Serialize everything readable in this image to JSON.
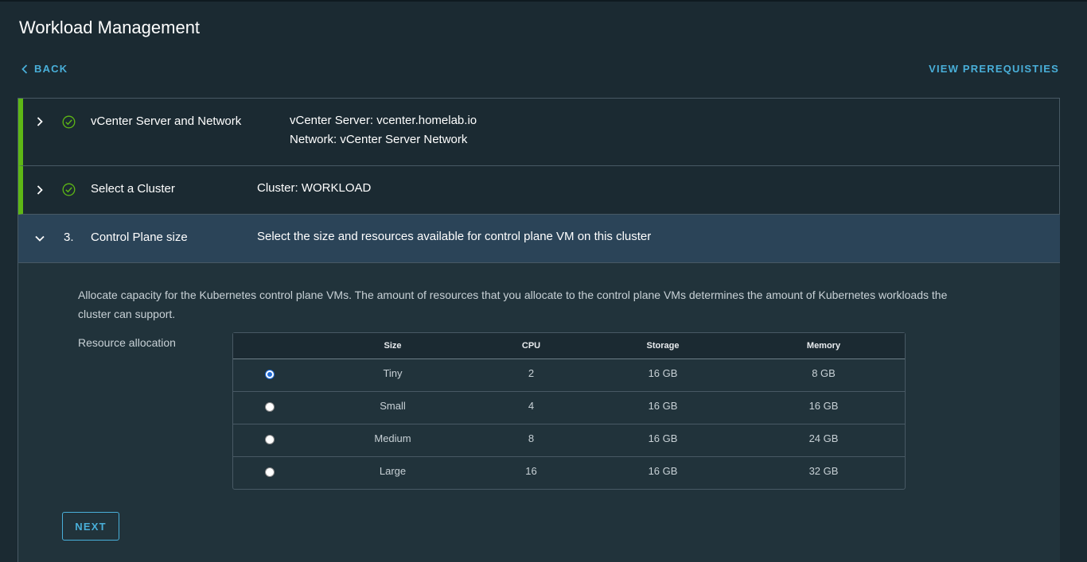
{
  "page": {
    "title": "Workload Management"
  },
  "nav": {
    "back_label": "BACK",
    "prereq_label": "VIEW PREREQUISTIES"
  },
  "steps": [
    {
      "title": "vCenter Server and Network",
      "summary_line1": "vCenter Server: vcenter.homelab.io",
      "summary_line2": "Network: vCenter Server Network",
      "status": "complete",
      "status_icon": "check-circle-icon",
      "toggle_icon": "chevron-right-icon"
    },
    {
      "title": "Select a Cluster",
      "summary_line1": "Cluster: WORKLOAD",
      "status": "complete",
      "status_icon": "check-circle-icon",
      "toggle_icon": "chevron-right-icon"
    },
    {
      "number": "3.",
      "title": "Control Plane size",
      "summary_line1": "Select the size and resources available for control plane VM on this cluster",
      "status": "active",
      "toggle_icon": "chevron-down-icon"
    }
  ],
  "control_plane": {
    "description": "Allocate capacity for the Kubernetes control plane VMs. The amount of resources that you allocate to the control plane VMs determines the amount of Kubernetes workloads the cluster can support.",
    "allocation_label": "Resource allocation",
    "table": {
      "headers": {
        "size": "Size",
        "cpu": "CPU",
        "storage": "Storage",
        "memory": "Memory"
      },
      "rows": [
        {
          "size": "Tiny",
          "cpu": "2",
          "storage": "16 GB",
          "memory": "8 GB",
          "selected": true
        },
        {
          "size": "Small",
          "cpu": "4",
          "storage": "16 GB",
          "memory": "16 GB",
          "selected": false
        },
        {
          "size": "Medium",
          "cpu": "8",
          "storage": "16 GB",
          "memory": "24 GB",
          "selected": false
        },
        {
          "size": "Large",
          "cpu": "16",
          "storage": "16 GB",
          "memory": "32 GB",
          "selected": false
        }
      ]
    },
    "next_label": "NEXT"
  },
  "colors": {
    "background": "#1b2a32",
    "accent_link": "#49afd9",
    "complete_bar": "#5eb715",
    "active_step_bg": "#2b4458",
    "radio_selected": "#1e6ad6"
  }
}
